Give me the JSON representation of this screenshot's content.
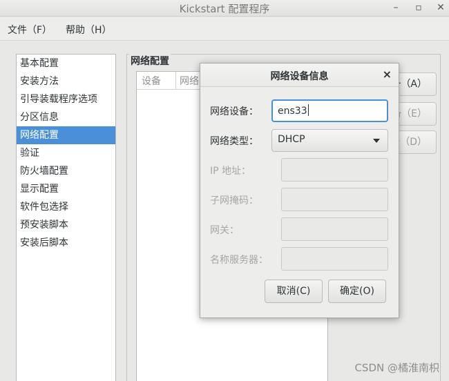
{
  "window": {
    "title": "Kickstart 配置程序",
    "controls": [
      "minimize",
      "maximize",
      "close"
    ]
  },
  "menu": {
    "items": [
      "文件（F）",
      "帮助（H）"
    ]
  },
  "sidebar": {
    "items": [
      "基本配置",
      "安装方法",
      "引导装载程序选项",
      "分区信息",
      "网络配置",
      "验证",
      "防火墙配置",
      "显示配置",
      "软件包选择",
      "预安装脚本",
      "安装后脚本"
    ],
    "selected": "网络配置"
  },
  "network": {
    "title": "网络配置",
    "columns": [
      "设备",
      "网络"
    ],
    "buttons": [
      {
        "label": "备（A）",
        "enabled": true
      },
      {
        "label": "备（E）",
        "enabled": false
      },
      {
        "label": "备（D）",
        "enabled": false
      }
    ]
  },
  "dialog": {
    "title": "网络设备信息",
    "close_icon": "close-icon",
    "fields": {
      "device_label": "网络设备：",
      "device_value": "ens33",
      "type_label": "网络类型：",
      "type_value": "DHCP",
      "ip_label": "IP 地址：",
      "netmask_label": "子网掩码：",
      "gateway_label": "网关：",
      "nameserver_label": "名称服务器："
    },
    "cancel_label": "取消(C)",
    "ok_label": "确定(O)"
  },
  "watermark": "CSDN @橘淮南枳",
  "colors": {
    "selection": "#4a90d9",
    "focus": "#4a90d9"
  }
}
